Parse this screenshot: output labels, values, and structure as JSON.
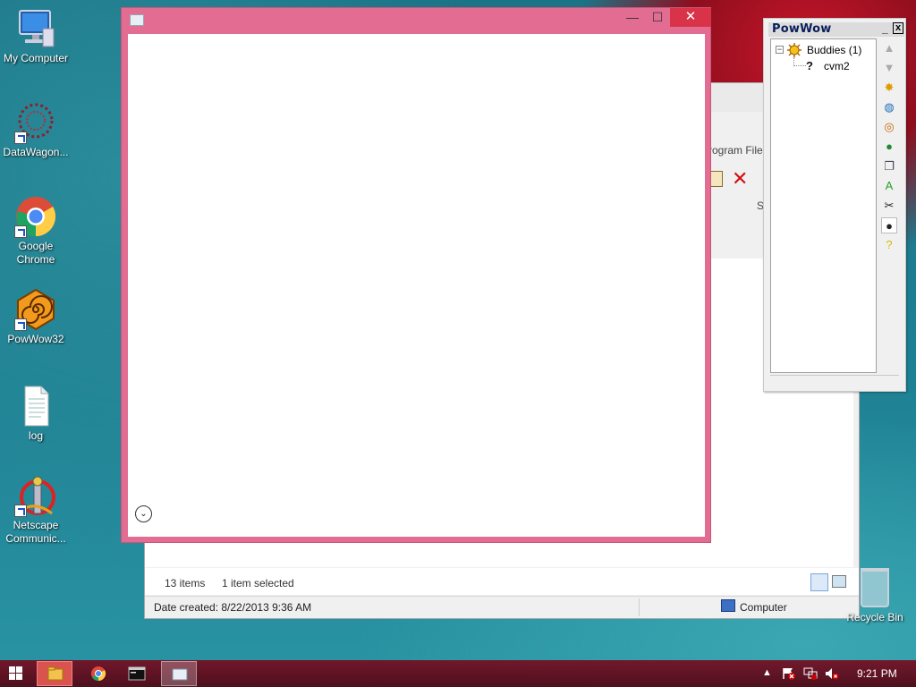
{
  "desktop": {
    "icons": [
      {
        "label": "My Computer"
      },
      {
        "label": "DataWagon..."
      },
      {
        "label": "Google Chrome"
      },
      {
        "label": "PowWow32"
      },
      {
        "label": "log"
      },
      {
        "label": "Netscape Communic..."
      }
    ],
    "recycle_bin": "Recycle Bin"
  },
  "explorer": {
    "address_partial": "rogram File",
    "column_partial": "S",
    "status": {
      "items": "13 items",
      "selected": "1 item selected"
    },
    "statusbar": {
      "date_created": "Date created: 8/22/2013 9:36 AM",
      "location": "Computer"
    }
  },
  "blank_window": {
    "controls": {
      "minimize": "—",
      "maximize": "☐",
      "close": "✕"
    },
    "expand_glyph": "⌄"
  },
  "powwow": {
    "title": "PowWow",
    "min_label": "_",
    "close_label": "x",
    "group": {
      "toggle": "−",
      "label": "Buddies (1)"
    },
    "buddy": {
      "status_glyph": "?",
      "name": "cvm2"
    }
  },
  "taskbar": {
    "clock": "9:21 PM",
    "tray_arrow": "▲"
  },
  "colors": {
    "window_border": "#e36c92",
    "close_button": "#d9334a",
    "taskbar": "#6a0a1e",
    "powwow_title": "#0a1e5a"
  }
}
